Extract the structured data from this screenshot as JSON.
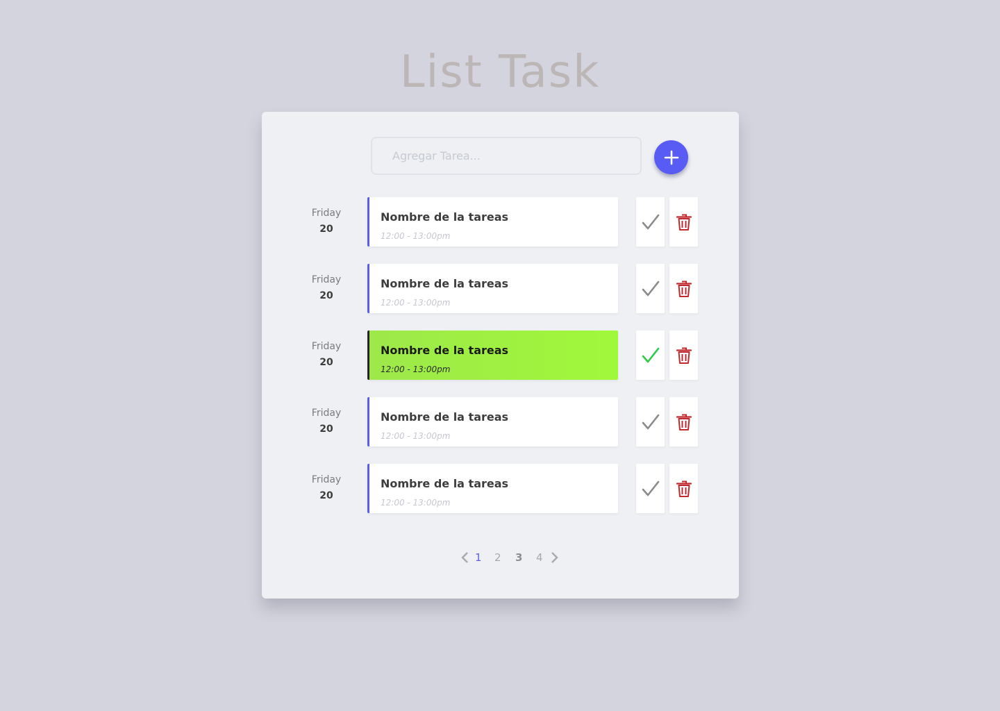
{
  "header": {
    "title": "List Task"
  },
  "add_task": {
    "placeholder": "Agregar Tarea...",
    "button_icon": "plus-icon"
  },
  "tasks": [
    {
      "day": "Friday",
      "date": "20",
      "name": "Nombre de la tareas",
      "time": "12:00 - 13:00pm",
      "completed": false
    },
    {
      "day": "Friday",
      "date": "20",
      "name": "Nombre de la tareas",
      "time": "12:00 - 13:00pm",
      "completed": false
    },
    {
      "day": "Friday",
      "date": "20",
      "name": "Nombre de la tareas",
      "time": "12:00 - 13:00pm",
      "completed": true
    },
    {
      "day": "Friday",
      "date": "20",
      "name": "Nombre de la tareas",
      "time": "12:00 - 13:00pm",
      "completed": false
    },
    {
      "day": "Friday",
      "date": "20",
      "name": "Nombre de la tareas",
      "time": "12:00 - 13:00pm",
      "completed": false
    }
  ],
  "pagination": {
    "pages": [
      "1",
      "2",
      "3",
      "4"
    ],
    "current": "1",
    "prev_icon": "chevron-left-icon",
    "next_icon": "chevron-right-icon"
  },
  "colors": {
    "background": "#d4d4de",
    "card": "#eef0f4",
    "accent": "#585cf5",
    "completed": "#a0f83a",
    "check_done": "#2fc94a",
    "delete": "#c0282d"
  }
}
